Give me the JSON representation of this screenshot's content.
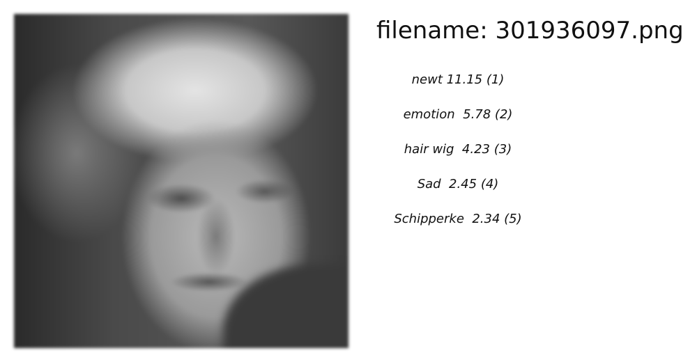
{
  "filename_title": "filename: 301936097.png",
  "predictions": [
    {
      "text": "newt 11.15 (1)"
    },
    {
      "text": "emotion  5.78 (2)"
    },
    {
      "text": "hair wig  4.23 (3)"
    },
    {
      "text": "Sad  2.45 (4)"
    },
    {
      "text": "Schipperke  2.34 (5)"
    }
  ]
}
